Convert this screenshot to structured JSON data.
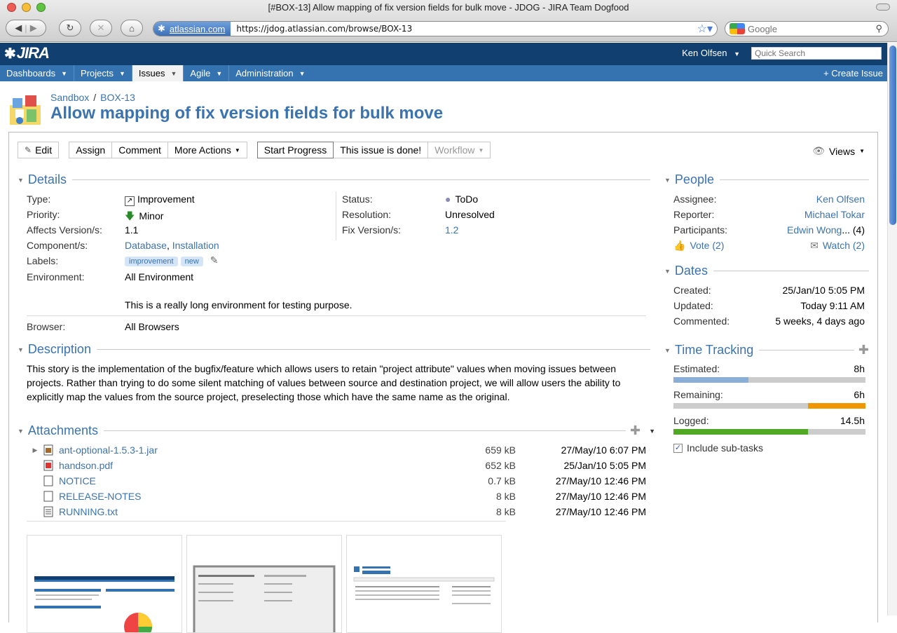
{
  "browser": {
    "title": "[#BOX-13] Allow mapping of fix version fields for bulk move - JDOG - JIRA Team Dogfood",
    "site_chip": "atlassian.com",
    "url": "https://jdog.atlassian.com/browse/BOX-13",
    "search_placeholder": "Google"
  },
  "jira": {
    "logo": "JIRA",
    "user": "Ken Olfsen",
    "quick_search_placeholder": "Quick Search",
    "nav": [
      "Dashboards",
      "Projects",
      "Issues",
      "Agile",
      "Administration"
    ],
    "active_nav": "Issues",
    "create_issue": "Create Issue"
  },
  "issue": {
    "project": "Sandbox",
    "key": "BOX-13",
    "title": "Allow mapping of fix version fields for bulk move",
    "ops": {
      "edit": "Edit",
      "assign": "Assign",
      "comment": "Comment",
      "more_actions": "More Actions",
      "start_progress": "Start Progress",
      "done": "This issue is done!",
      "workflow": "Workflow",
      "views": "Views"
    }
  },
  "details": {
    "heading": "Details",
    "type_label": "Type:",
    "type": "Improvement",
    "priority_label": "Priority:",
    "priority": "Minor",
    "affects_label": "Affects Version/s:",
    "affects": "1.1",
    "components_label": "Component/s:",
    "component1": "Database",
    "component_sep": ",",
    "component2": "Installation",
    "labels_label": "Labels:",
    "label1": "improvement",
    "label2": "new",
    "environment_label": "Environment:",
    "environment": "All Environment",
    "environment_extra": "This is a really long environment for testing purpose.",
    "browser_label": "Browser:",
    "browser": "All Browsers",
    "status_label": "Status:",
    "status": "ToDo",
    "resolution_label": "Resolution:",
    "resolution": "Unresolved",
    "fix_label": "Fix Version/s:",
    "fix": "1.2"
  },
  "description": {
    "heading": "Description",
    "text": "This story is the implementation of the bugfix/feature which allows users to retain \"project attribute\" values when moving issues between projects. Rather than trying to do some silent matching of values between source and destination project, we will allow users the ability to explicitly map the values from the source project, preselecting those which have the same name as the original."
  },
  "attachments": {
    "heading": "Attachments",
    "files": [
      {
        "name": "ant-optional-1.5.3-1.jar",
        "size": "659 kB",
        "date": "27/May/10 6:07 PM",
        "icon": "jar-icon"
      },
      {
        "name": "handson.pdf",
        "size": "652 kB",
        "date": "25/Jan/10 5:05 PM",
        "icon": "pdf-icon"
      },
      {
        "name": "NOTICE",
        "size": "0.7 kB",
        "date": "27/May/10 12:46 PM",
        "icon": "file-icon"
      },
      {
        "name": "RELEASE-NOTES",
        "size": "8 kB",
        "date": "27/May/10 12:46 PM",
        "icon": "file-icon"
      },
      {
        "name": "RUNNING.txt",
        "size": "8 kB",
        "date": "27/May/10 12:46 PM",
        "icon": "text-file-icon"
      }
    ]
  },
  "people": {
    "heading": "People",
    "assignee_label": "Assignee:",
    "assignee": "Ken Olfsen",
    "reporter_label": "Reporter:",
    "reporter": "Michael Tokar",
    "participants_label": "Participants:",
    "participants": "Edwin Wong",
    "participants_more": "... (4)",
    "vote": "Vote (2)",
    "watch": "Watch (2)"
  },
  "dates": {
    "heading": "Dates",
    "created_label": "Created:",
    "created": "25/Jan/10 5:05 PM",
    "updated_label": "Updated:",
    "updated": "Today 9:11 AM",
    "commented_label": "Commented:",
    "commented": "5 weeks, 4 days ago"
  },
  "time_tracking": {
    "heading": "Time Tracking",
    "estimated_label": "Estimated:",
    "estimated": "8h",
    "estimated_fraction": 0.39,
    "remaining_label": "Remaining:",
    "remaining": "6h",
    "remaining_fraction": 0.3,
    "logged_label": "Logged:",
    "logged": "14.5h",
    "logged_fraction": 0.7,
    "include_subtasks": "Include sub-tasks",
    "colors": {
      "estimated": "#89afd7",
      "remaining": "#f09700",
      "logged": "#51a825"
    }
  },
  "colors": {
    "brand_header": "#114070",
    "nav": "#3572b0",
    "link": "#3b73af"
  }
}
